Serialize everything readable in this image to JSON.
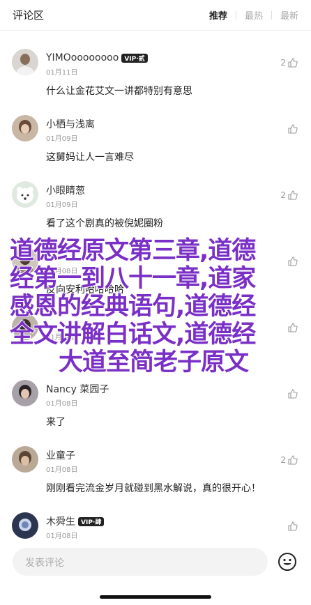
{
  "header": {
    "title": "评论区",
    "tabs": [
      "推荐",
      "最热",
      "最新"
    ]
  },
  "comments": [
    {
      "name": "YIMOoooooooo",
      "vip": "VIP·贰",
      "date": "01月11日",
      "text": "什么让金花艾文一讲都特别有意思",
      "likes": "2"
    },
    {
      "name": "小栖与浅离",
      "vip": "",
      "date": "01月09日",
      "text": "这舅妈让人一言难尽",
      "likes": ""
    },
    {
      "name": "小眼睛葱",
      "vip": "",
      "date": "01月09日",
      "text": "看了这个剧真的被倪妮圈粉",
      "likes": "2"
    },
    {
      "name": "",
      "vip": "",
      "date": "01月08日",
      "text": "反向安利哈哈哈哈",
      "likes": ""
    },
    {
      "name": "",
      "vip": "",
      "date": "01月08日",
      "text": "",
      "likes": ""
    },
    {
      "name": "Nancy 菜园子",
      "vip": "",
      "date": "01月08日",
      "text": "来了",
      "likes": ""
    },
    {
      "name": "业童子",
      "vip": "",
      "date": "01月08日",
      "text": "刚刚看完流金岁月就碰到黑水解说，真的很开心！",
      "likes": "2"
    },
    {
      "name": "木舜生",
      "vip": "VIP·肆",
      "date": "01月08日",
      "text": "",
      "likes": ""
    }
  ],
  "overlay": {
    "lines": [
      "道德经原文第三章,道德",
      "经第一到八十一章,道家",
      "感恩的经典语句,道德经",
      "全文讲解白话文,道德经",
      "大道至简老子原文"
    ]
  },
  "footer": {
    "input_placeholder": "发表评论"
  },
  "colors": {
    "overlay": "#7a2fc6",
    "vip_badge": "#222222"
  }
}
